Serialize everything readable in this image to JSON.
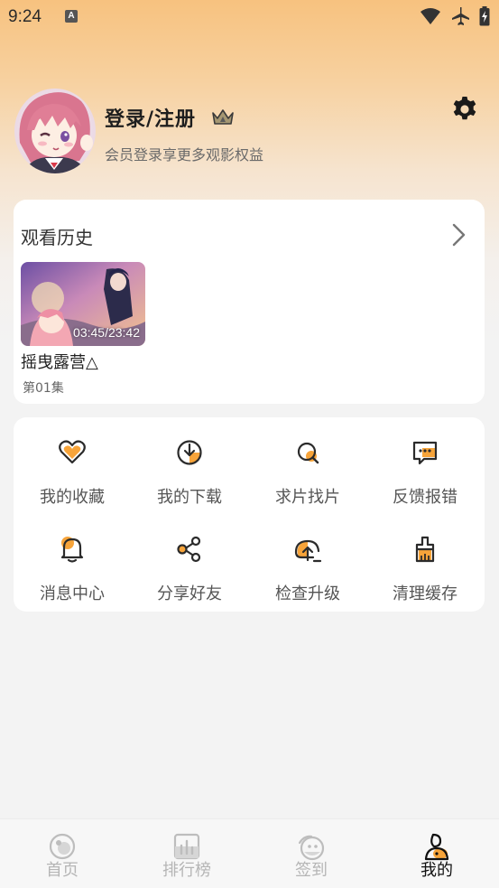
{
  "status_bar": {
    "time": "9:24",
    "notification_icon_letter": "A",
    "icons": [
      "wifi-icon",
      "airplane-icon",
      "battery-charging-icon"
    ]
  },
  "profile": {
    "title": "登录/注册",
    "subtitle": "会员登录享更多观影权益",
    "crown_icon": "crown-icon",
    "settings_icon": "gear-icon"
  },
  "history": {
    "title": "观看历史",
    "items": [
      {
        "time": "03:45/23:42",
        "title": "摇曳露营△",
        "episode": "第01集"
      }
    ]
  },
  "menu": {
    "items": [
      {
        "label": "我的收藏",
        "icon": "heart-icon"
      },
      {
        "label": "我的下载",
        "icon": "download-icon"
      },
      {
        "label": "求片找片",
        "icon": "search-icon"
      },
      {
        "label": "反馈报错",
        "icon": "feedback-icon"
      },
      {
        "label": "消息中心",
        "icon": "bell-icon"
      },
      {
        "label": "分享好友",
        "icon": "share-icon"
      },
      {
        "label": "检查升级",
        "icon": "upload-icon"
      },
      {
        "label": "清理缓存",
        "icon": "broom-icon"
      }
    ]
  },
  "bottom_nav": {
    "items": [
      {
        "label": "首页",
        "icon": "home-icon",
        "active": false
      },
      {
        "label": "排行榜",
        "icon": "ranking-icon",
        "active": false
      },
      {
        "label": "签到",
        "icon": "checkin-icon",
        "active": false
      },
      {
        "label": "我的",
        "icon": "profile-icon",
        "active": true
      }
    ]
  },
  "colors": {
    "accent": "#f7a43a",
    "icon_stroke": "#2b2b2b",
    "inactive_nav": "#b5b5b5"
  }
}
